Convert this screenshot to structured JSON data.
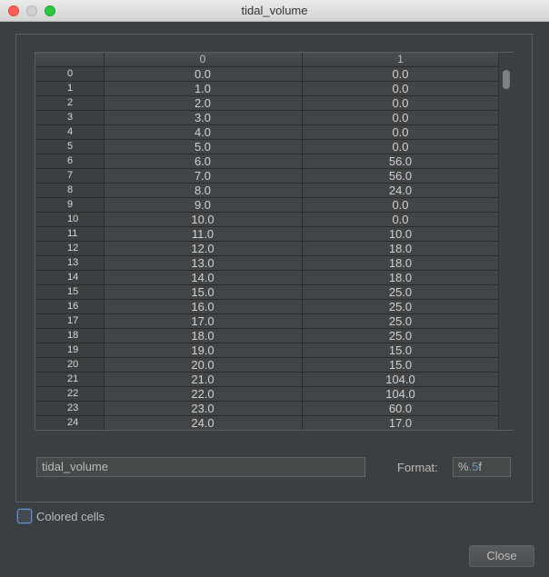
{
  "window": {
    "title": "tidal_volume"
  },
  "table": {
    "columns": [
      "0",
      "1"
    ],
    "rows": [
      {
        "index": "0",
        "c0": "0.0",
        "c1": "0.0"
      },
      {
        "index": "1",
        "c0": "1.0",
        "c1": "0.0"
      },
      {
        "index": "2",
        "c0": "2.0",
        "c1": "0.0"
      },
      {
        "index": "3",
        "c0": "3.0",
        "c1": "0.0"
      },
      {
        "index": "4",
        "c0": "4.0",
        "c1": "0.0"
      },
      {
        "index": "5",
        "c0": "5.0",
        "c1": "0.0"
      },
      {
        "index": "6",
        "c0": "6.0",
        "c1": "56.0"
      },
      {
        "index": "7",
        "c0": "7.0",
        "c1": "56.0"
      },
      {
        "index": "8",
        "c0": "8.0",
        "c1": "24.0"
      },
      {
        "index": "9",
        "c0": "9.0",
        "c1": "0.0"
      },
      {
        "index": "10",
        "c0": "10.0",
        "c1": "0.0"
      },
      {
        "index": "11",
        "c0": "11.0",
        "c1": "10.0"
      },
      {
        "index": "12",
        "c0": "12.0",
        "c1": "18.0"
      },
      {
        "index": "13",
        "c0": "13.0",
        "c1": "18.0"
      },
      {
        "index": "14",
        "c0": "14.0",
        "c1": "18.0"
      },
      {
        "index": "15",
        "c0": "15.0",
        "c1": "25.0"
      },
      {
        "index": "16",
        "c0": "16.0",
        "c1": "25.0"
      },
      {
        "index": "17",
        "c0": "17.0",
        "c1": "25.0"
      },
      {
        "index": "18",
        "c0": "18.0",
        "c1": "25.0"
      },
      {
        "index": "19",
        "c0": "19.0",
        "c1": "15.0"
      },
      {
        "index": "20",
        "c0": "20.0",
        "c1": "15.0"
      },
      {
        "index": "21",
        "c0": "21.0",
        "c1": "104.0"
      },
      {
        "index": "22",
        "c0": "22.0",
        "c1": "104.0"
      },
      {
        "index": "23",
        "c0": "23.0",
        "c1": "60.0"
      },
      {
        "index": "24",
        "c0": "24.0",
        "c1": "17.0"
      }
    ]
  },
  "name_field": {
    "value": "tidal_volume"
  },
  "format": {
    "label": "Format:",
    "prefix": "%",
    "number": ".5",
    "suffix": "f"
  },
  "colored_cells": {
    "label": "Colored cells",
    "checked": false
  },
  "close_button": {
    "label": "Close"
  }
}
